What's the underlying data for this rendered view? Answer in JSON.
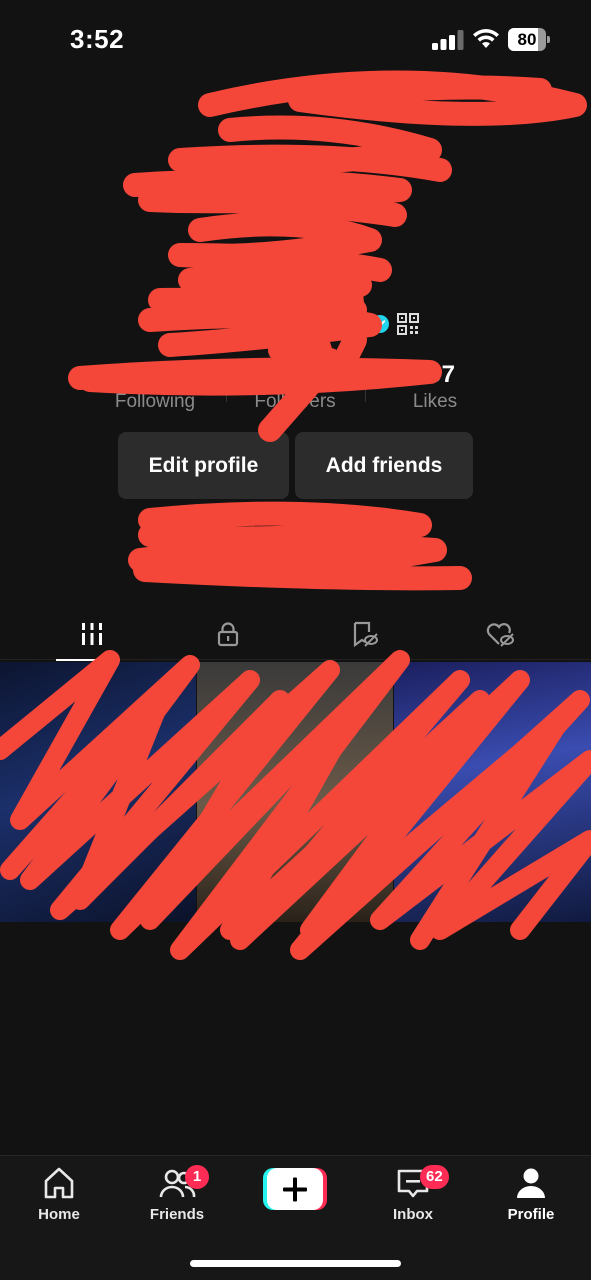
{
  "status_bar": {
    "time": "3:52",
    "battery_level": "80",
    "battery_fraction": 0.8
  },
  "profile": {
    "verified_icon": "verified-badge-icon",
    "qr_icon": "qr-code-icon",
    "stats": {
      "following_label": "Following",
      "followers_label": "Followers",
      "likes_label": "Likes",
      "likes_partial": "597"
    },
    "buttons": {
      "edit_profile": "Edit profile",
      "add_friends": "Add friends"
    }
  },
  "tabs": [
    {
      "name": "videos-tab",
      "icon": "grid-lines-icon",
      "active": true
    },
    {
      "name": "private-tab",
      "icon": "lock-icon",
      "active": false
    },
    {
      "name": "saved-tab",
      "icon": "bookmark-hidden-icon",
      "active": false
    },
    {
      "name": "liked-tab",
      "icon": "heart-hidden-icon",
      "active": false
    }
  ],
  "bottom_nav": {
    "home": {
      "label": "Home",
      "icon": "home-icon"
    },
    "friends": {
      "label": "Friends",
      "icon": "friends-icon",
      "badge": "1"
    },
    "create": {
      "label": "",
      "icon": "plus-icon"
    },
    "inbox": {
      "label": "Inbox",
      "icon": "inbox-icon",
      "badge": "62"
    },
    "profile": {
      "label": "Profile",
      "icon": "profile-icon"
    }
  },
  "colors": {
    "background": "#121212",
    "button_bg": "#2c2c2c",
    "badge": "#fe2c55",
    "redaction": "#f5463a",
    "accent_cyan": "#25f4ee",
    "verified": "#20d5ec"
  }
}
